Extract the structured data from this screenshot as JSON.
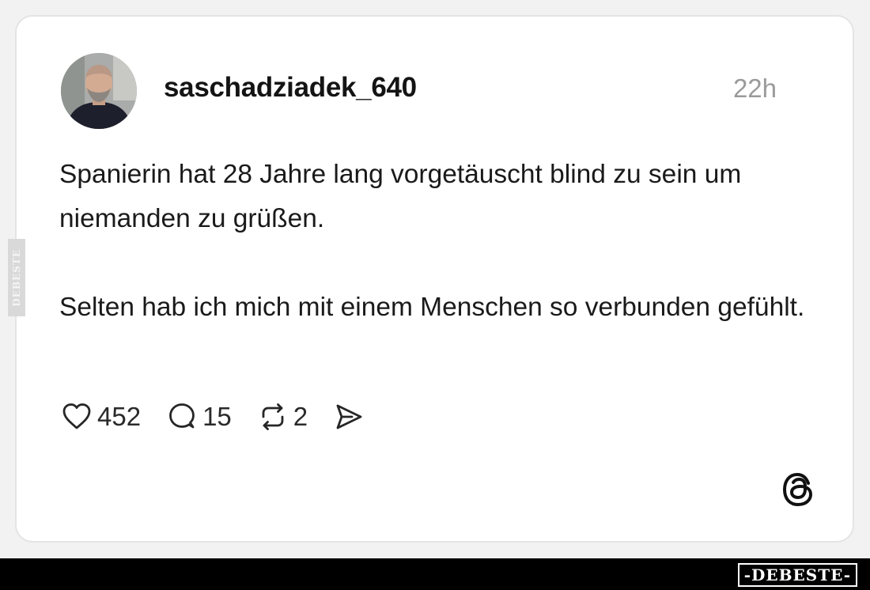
{
  "post": {
    "username": "saschadziadek_640",
    "timestamp": "22h",
    "paragraphs": [
      "Spanierin hat 28 Jahre lang vorgetäuscht blind zu sein um niemanden zu grüßen.",
      "Selten hab ich mich mit einem Menschen so verbunden gefühlt."
    ]
  },
  "actions": {
    "likes": "452",
    "comments": "15",
    "reposts": "2"
  },
  "icons": {
    "like": "heart-icon",
    "comment": "speech-bubble-icon",
    "repost": "repost-arrows-icon",
    "share": "paper-plane-icon",
    "brand": "threads-logo-icon"
  },
  "watermarks": {
    "side": "DEBESTE",
    "footer": "-DEBESTE-"
  },
  "colors": {
    "card_background": "#ffffff",
    "page_background": "#f2f2f2",
    "text": "#1a1a1a",
    "muted": "#9a9a9a",
    "footer_bar": "#000000"
  }
}
